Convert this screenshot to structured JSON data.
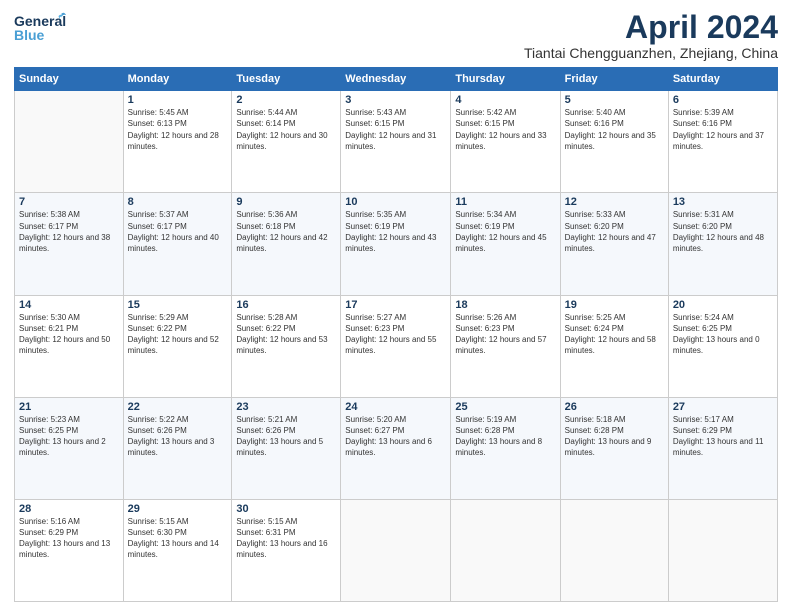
{
  "header": {
    "logo_line1": "General",
    "logo_line2": "Blue",
    "month": "April 2024",
    "location": "Tiantai Chengguanzhen, Zhejiang, China"
  },
  "weekdays": [
    "Sunday",
    "Monday",
    "Tuesday",
    "Wednesday",
    "Thursday",
    "Friday",
    "Saturday"
  ],
  "weeks": [
    [
      {
        "day": "",
        "sunrise": "",
        "sunset": "",
        "daylight": ""
      },
      {
        "day": "1",
        "sunrise": "Sunrise: 5:45 AM",
        "sunset": "Sunset: 6:13 PM",
        "daylight": "Daylight: 12 hours and 28 minutes."
      },
      {
        "day": "2",
        "sunrise": "Sunrise: 5:44 AM",
        "sunset": "Sunset: 6:14 PM",
        "daylight": "Daylight: 12 hours and 30 minutes."
      },
      {
        "day": "3",
        "sunrise": "Sunrise: 5:43 AM",
        "sunset": "Sunset: 6:15 PM",
        "daylight": "Daylight: 12 hours and 31 minutes."
      },
      {
        "day": "4",
        "sunrise": "Sunrise: 5:42 AM",
        "sunset": "Sunset: 6:15 PM",
        "daylight": "Daylight: 12 hours and 33 minutes."
      },
      {
        "day": "5",
        "sunrise": "Sunrise: 5:40 AM",
        "sunset": "Sunset: 6:16 PM",
        "daylight": "Daylight: 12 hours and 35 minutes."
      },
      {
        "day": "6",
        "sunrise": "Sunrise: 5:39 AM",
        "sunset": "Sunset: 6:16 PM",
        "daylight": "Daylight: 12 hours and 37 minutes."
      }
    ],
    [
      {
        "day": "7",
        "sunrise": "Sunrise: 5:38 AM",
        "sunset": "Sunset: 6:17 PM",
        "daylight": "Daylight: 12 hours and 38 minutes."
      },
      {
        "day": "8",
        "sunrise": "Sunrise: 5:37 AM",
        "sunset": "Sunset: 6:17 PM",
        "daylight": "Daylight: 12 hours and 40 minutes."
      },
      {
        "day": "9",
        "sunrise": "Sunrise: 5:36 AM",
        "sunset": "Sunset: 6:18 PM",
        "daylight": "Daylight: 12 hours and 42 minutes."
      },
      {
        "day": "10",
        "sunrise": "Sunrise: 5:35 AM",
        "sunset": "Sunset: 6:19 PM",
        "daylight": "Daylight: 12 hours and 43 minutes."
      },
      {
        "day": "11",
        "sunrise": "Sunrise: 5:34 AM",
        "sunset": "Sunset: 6:19 PM",
        "daylight": "Daylight: 12 hours and 45 minutes."
      },
      {
        "day": "12",
        "sunrise": "Sunrise: 5:33 AM",
        "sunset": "Sunset: 6:20 PM",
        "daylight": "Daylight: 12 hours and 47 minutes."
      },
      {
        "day": "13",
        "sunrise": "Sunrise: 5:31 AM",
        "sunset": "Sunset: 6:20 PM",
        "daylight": "Daylight: 12 hours and 48 minutes."
      }
    ],
    [
      {
        "day": "14",
        "sunrise": "Sunrise: 5:30 AM",
        "sunset": "Sunset: 6:21 PM",
        "daylight": "Daylight: 12 hours and 50 minutes."
      },
      {
        "day": "15",
        "sunrise": "Sunrise: 5:29 AM",
        "sunset": "Sunset: 6:22 PM",
        "daylight": "Daylight: 12 hours and 52 minutes."
      },
      {
        "day": "16",
        "sunrise": "Sunrise: 5:28 AM",
        "sunset": "Sunset: 6:22 PM",
        "daylight": "Daylight: 12 hours and 53 minutes."
      },
      {
        "day": "17",
        "sunrise": "Sunrise: 5:27 AM",
        "sunset": "Sunset: 6:23 PM",
        "daylight": "Daylight: 12 hours and 55 minutes."
      },
      {
        "day": "18",
        "sunrise": "Sunrise: 5:26 AM",
        "sunset": "Sunset: 6:23 PM",
        "daylight": "Daylight: 12 hours and 57 minutes."
      },
      {
        "day": "19",
        "sunrise": "Sunrise: 5:25 AM",
        "sunset": "Sunset: 6:24 PM",
        "daylight": "Daylight: 12 hours and 58 minutes."
      },
      {
        "day": "20",
        "sunrise": "Sunrise: 5:24 AM",
        "sunset": "Sunset: 6:25 PM",
        "daylight": "Daylight: 13 hours and 0 minutes."
      }
    ],
    [
      {
        "day": "21",
        "sunrise": "Sunrise: 5:23 AM",
        "sunset": "Sunset: 6:25 PM",
        "daylight": "Daylight: 13 hours and 2 minutes."
      },
      {
        "day": "22",
        "sunrise": "Sunrise: 5:22 AM",
        "sunset": "Sunset: 6:26 PM",
        "daylight": "Daylight: 13 hours and 3 minutes."
      },
      {
        "day": "23",
        "sunrise": "Sunrise: 5:21 AM",
        "sunset": "Sunset: 6:26 PM",
        "daylight": "Daylight: 13 hours and 5 minutes."
      },
      {
        "day": "24",
        "sunrise": "Sunrise: 5:20 AM",
        "sunset": "Sunset: 6:27 PM",
        "daylight": "Daylight: 13 hours and 6 minutes."
      },
      {
        "day": "25",
        "sunrise": "Sunrise: 5:19 AM",
        "sunset": "Sunset: 6:28 PM",
        "daylight": "Daylight: 13 hours and 8 minutes."
      },
      {
        "day": "26",
        "sunrise": "Sunrise: 5:18 AM",
        "sunset": "Sunset: 6:28 PM",
        "daylight": "Daylight: 13 hours and 9 minutes."
      },
      {
        "day": "27",
        "sunrise": "Sunrise: 5:17 AM",
        "sunset": "Sunset: 6:29 PM",
        "daylight": "Daylight: 13 hours and 11 minutes."
      }
    ],
    [
      {
        "day": "28",
        "sunrise": "Sunrise: 5:16 AM",
        "sunset": "Sunset: 6:29 PM",
        "daylight": "Daylight: 13 hours and 13 minutes."
      },
      {
        "day": "29",
        "sunrise": "Sunrise: 5:15 AM",
        "sunset": "Sunset: 6:30 PM",
        "daylight": "Daylight: 13 hours and 14 minutes."
      },
      {
        "day": "30",
        "sunrise": "Sunrise: 5:15 AM",
        "sunset": "Sunset: 6:31 PM",
        "daylight": "Daylight: 13 hours and 16 minutes."
      },
      {
        "day": "",
        "sunrise": "",
        "sunset": "",
        "daylight": ""
      },
      {
        "day": "",
        "sunrise": "",
        "sunset": "",
        "daylight": ""
      },
      {
        "day": "",
        "sunrise": "",
        "sunset": "",
        "daylight": ""
      },
      {
        "day": "",
        "sunrise": "",
        "sunset": "",
        "daylight": ""
      }
    ]
  ]
}
